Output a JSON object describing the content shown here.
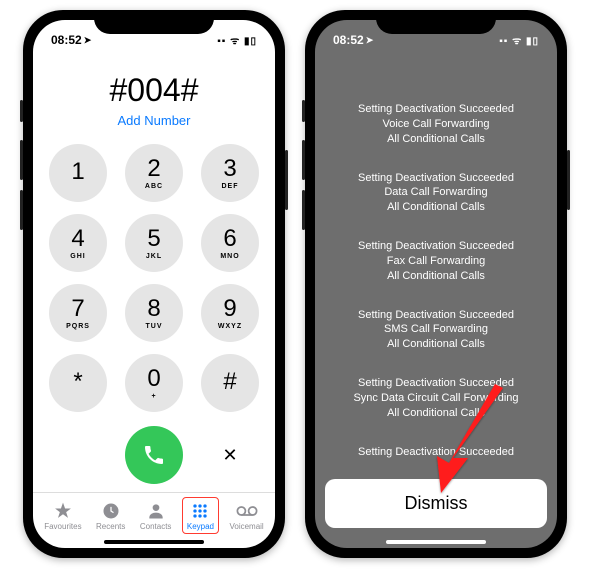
{
  "status": {
    "time": "08:52",
    "loc_icon": "➤",
    "right": "▪▪ ᯤ ▮▯"
  },
  "dialer": {
    "number": "#004#",
    "add_number_label": "Add Number",
    "keys": [
      {
        "num": "1",
        "sub": ""
      },
      {
        "num": "2",
        "sub": "ABC"
      },
      {
        "num": "3",
        "sub": "DEF"
      },
      {
        "num": "4",
        "sub": "GHI"
      },
      {
        "num": "5",
        "sub": "JKL"
      },
      {
        "num": "6",
        "sub": "MNO"
      },
      {
        "num": "7",
        "sub": "PQRS"
      },
      {
        "num": "8",
        "sub": "TUV"
      },
      {
        "num": "9",
        "sub": "WXYZ"
      },
      {
        "num": "*",
        "sub": ""
      },
      {
        "num": "0",
        "sub": "+"
      },
      {
        "num": "#",
        "sub": ""
      }
    ],
    "delete_glyph": "✕"
  },
  "tabs": {
    "favourites": "Favourites",
    "recents": "Recents",
    "contacts": "Contacts",
    "keypad": "Keypad",
    "voicemail": "Voicemail"
  },
  "result": {
    "messages": [
      "Setting Deactivation Succeeded\nVoice Call Forwarding\nAll Conditional Calls",
      "Setting Deactivation Succeeded\nData Call Forwarding\nAll Conditional Calls",
      "Setting Deactivation Succeeded\nFax Call Forwarding\nAll Conditional Calls",
      "Setting Deactivation Succeeded\nSMS Call Forwarding\nAll Conditional Calls",
      "Setting Deactivation Succeeded\nSync Data Circuit Call Forwarding\nAll Conditional Calls",
      "Setting Deactivation Succeeded"
    ],
    "dismiss_label": "Dismiss"
  },
  "colors": {
    "link": "#0a7aff",
    "call_green": "#34c759",
    "highlight_red": "#ff3b30"
  }
}
